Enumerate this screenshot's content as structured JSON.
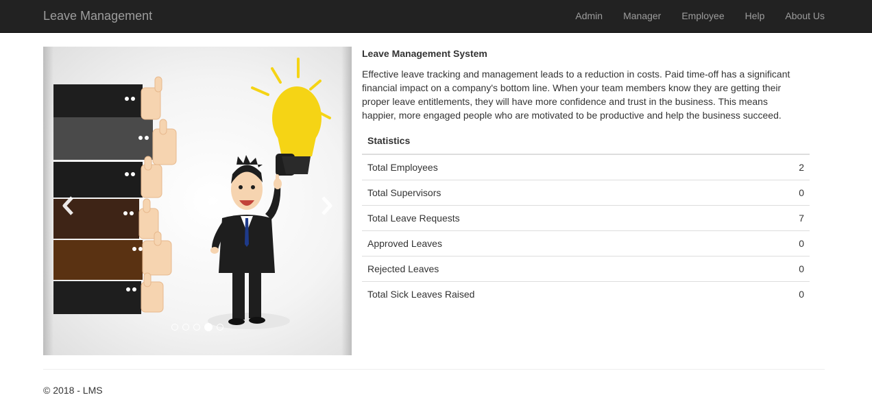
{
  "app": {
    "brand": "Leave Management"
  },
  "nav": {
    "items": [
      "Admin",
      "Manager",
      "Employee",
      "Help",
      "About Us"
    ]
  },
  "carousel": {
    "slide_count": 5,
    "active_slide": 4
  },
  "main": {
    "title": "Leave Management System",
    "intro": "Effective leave tracking and management leads to a reduction in costs. Paid time-off has a significant financial impact on a company's bottom line. When your team members know they are getting their proper leave entitlements, they will have more confidence and trust in the business. This means happier, more engaged people who are motivated to be productive and help the business succeed."
  },
  "stats": {
    "header": "Statistics",
    "rows": [
      {
        "label": "Total Employees",
        "value": "2"
      },
      {
        "label": "Total Supervisors",
        "value": "0"
      },
      {
        "label": "Total Leave Requests",
        "value": "7"
      },
      {
        "label": "Approved Leaves",
        "value": "0"
      },
      {
        "label": "Rejected Leaves",
        "value": "0"
      },
      {
        "label": "Total Sick Leaves Raised",
        "value": "0"
      }
    ]
  },
  "footer": {
    "text": "© 2018 - LMS"
  },
  "colors": {
    "navbar": "#222222",
    "nav_text": "#9d9d9d",
    "bulb": "#f5d415",
    "suit": "#1e1e1e"
  }
}
